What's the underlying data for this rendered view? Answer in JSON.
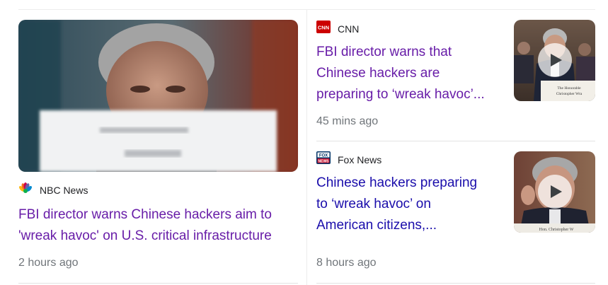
{
  "stories": [
    {
      "source": "NBC News",
      "source_icon": "nbc-peacock-icon",
      "headline": "FBI director warns Chinese hackers aim to 'wreak havoc' on U.S. critical infrastructure",
      "headline_line1": "FBI director warns Chinese hackers aim to",
      "headline_line2": "'wreak havoc' on U.S. critical infrastructure",
      "time": "2 hours ago",
      "visited": true
    },
    {
      "source": "CNN",
      "source_icon": "cnn-logo-icon",
      "headline_line1": "FBI director warns that",
      "headline_line2": "Chinese hackers are",
      "headline_line3": "preparing to ‘wreak havoc’...",
      "time": "45 mins ago",
      "has_video": true,
      "visited": true
    },
    {
      "source": "Fox News",
      "source_icon": "fox-news-logo-icon",
      "headline_line1": "Chinese hackers preparing",
      "headline_line2": "to ‘wreak havoc’ on",
      "headline_line3": "American citizens,...",
      "time": "8 hours ago",
      "has_video": true,
      "visited": false
    }
  ],
  "colors": {
    "visited_link": "#681da8",
    "unvisited_link": "#1a0dab",
    "meta_text": "#70757a",
    "cnn_red": "#cc0000",
    "fox_blue": "#003366"
  }
}
